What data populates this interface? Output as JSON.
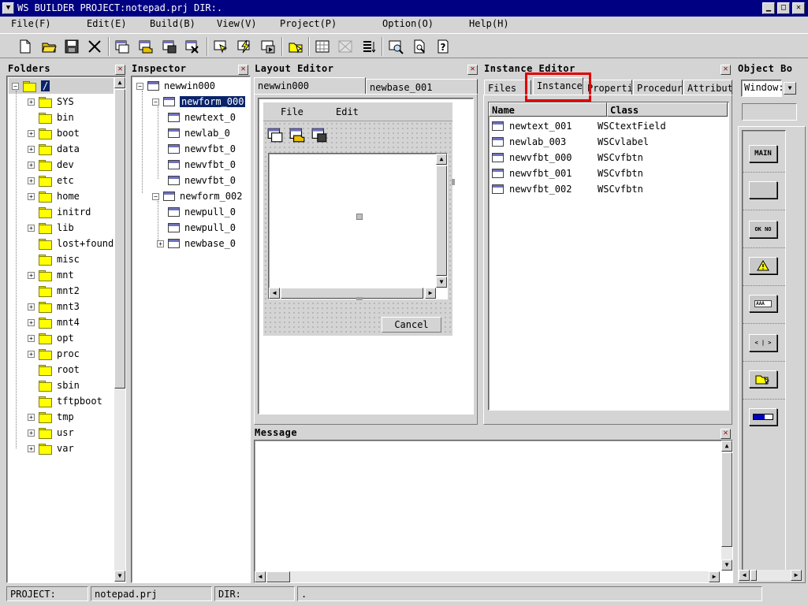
{
  "window": {
    "title": "WS BUILDER PROJECT:notepad.prj DIR:."
  },
  "menu": [
    {
      "label": "File(F)"
    },
    {
      "label": "Edit(E)"
    },
    {
      "label": "Build(B)"
    },
    {
      "label": "View(V)"
    },
    {
      "label": "Project(P)"
    },
    {
      "label": "Option(O)"
    },
    {
      "label": "Help(H)"
    }
  ],
  "panels": {
    "folders": {
      "title": "Folders",
      "root": "/",
      "items": [
        {
          "label": "SYS",
          "expandable": true
        },
        {
          "label": "bin",
          "expandable": false
        },
        {
          "label": "boot",
          "expandable": true
        },
        {
          "label": "data",
          "expandable": true
        },
        {
          "label": "dev",
          "expandable": true
        },
        {
          "label": "etc",
          "expandable": true
        },
        {
          "label": "home",
          "expandable": true
        },
        {
          "label": "initrd",
          "expandable": false
        },
        {
          "label": "lib",
          "expandable": true
        },
        {
          "label": "lost+found",
          "expandable": false
        },
        {
          "label": "misc",
          "expandable": false
        },
        {
          "label": "mnt",
          "expandable": true
        },
        {
          "label": "mnt2",
          "expandable": false
        },
        {
          "label": "mnt3",
          "expandable": true
        },
        {
          "label": "mnt4",
          "expandable": true
        },
        {
          "label": "opt",
          "expandable": true
        },
        {
          "label": "proc",
          "expandable": true
        },
        {
          "label": "root",
          "expandable": false
        },
        {
          "label": "sbin",
          "expandable": false
        },
        {
          "label": "tftpboot",
          "expandable": false
        },
        {
          "label": "tmp",
          "expandable": true
        },
        {
          "label": "usr",
          "expandable": true
        },
        {
          "label": "var",
          "expandable": true
        }
      ]
    },
    "inspector": {
      "title": "Inspector",
      "root": "newwin000",
      "form1": "newform_000",
      "form1_children": [
        "newtext_0",
        "newlab_0",
        "newvfbt_0",
        "newvfbt_0",
        "newvfbt_0"
      ],
      "form2": "newform_002",
      "form2_children": [
        "newpull_0",
        "newpull_0",
        "newbase_0"
      ]
    },
    "layout": {
      "title": "Layout Editor",
      "tabs": [
        "newwin000",
        "newbase_001"
      ],
      "preview_menu": [
        "File",
        "Edit"
      ],
      "cancel_label": "Cancel"
    },
    "instance": {
      "title": "Instance Editor",
      "tabs": [
        "Files",
        "Instance",
        "Properti",
        "Procedur",
        "Attribut"
      ],
      "columns": [
        "Name",
        "Class"
      ],
      "rows": [
        {
          "name": "newtext_001",
          "cls": "WSCtextField"
        },
        {
          "name": "newlab_003",
          "cls": "WSCvlabel"
        },
        {
          "name": "newvfbt_000",
          "cls": "WSCvfbtn"
        },
        {
          "name": "newvfbt_001",
          "cls": "WSCvfbtn"
        },
        {
          "name": "newvfbt_002",
          "cls": "WSCvfbtn"
        }
      ]
    },
    "objectbox": {
      "title": "Object Bo",
      "select_value": "Window:",
      "main_label": "MAIN",
      "okno_label": "OK NO",
      "aaa_label": "AAA",
      "lr_label": "< | >"
    },
    "message": {
      "title": "Message"
    }
  },
  "status": {
    "project_label": "PROJECT:",
    "project_value": "notepad.prj",
    "dir_label": "DIR:",
    "dir_value": "."
  },
  "colors": {
    "titlebar": "#000082",
    "highlight": "#e00000",
    "selection": "#0a246a"
  }
}
